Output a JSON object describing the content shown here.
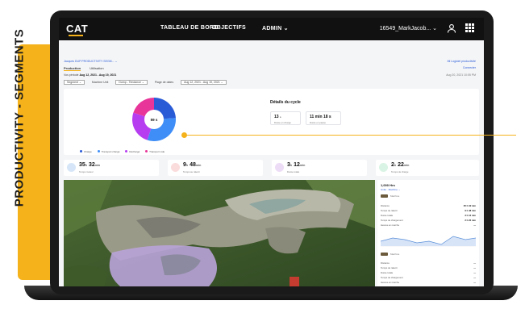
{
  "banner": {
    "text": "PRODUCTIVITY - SEGMENTS"
  },
  "nav": {
    "logo": "CAT",
    "items": [
      "TABLEAU DE BORD",
      "OBJECTIFS",
      "ADMIN ⌄"
    ],
    "user": "16549_MarkJacob... ⌄",
    "icons": [
      "user-icon",
      "apps-grid-icon"
    ]
  },
  "subheader": {
    "breadcrumb": "Jacques DUP PRODUCTIVITY SEGM... ⌄",
    "breadcrumb_right": "Mi Logiciel productivité",
    "tabs": [
      "Production",
      "Utilisation"
    ],
    "tab_right": "Connecter",
    "period_prefix": "Vos période",
    "period": "Aug 12, 2021 - Aug 19, 2021",
    "period_right": "Aug 20, 2021 10:05 PM",
    "filters": [
      {
        "label": "Segment ⌄"
      },
      {
        "label": "Machine Unit",
        "value": "Dump - Tendance ⌄"
      },
      {
        "label": "Plage de dates",
        "value": "Aug 12, 2021 - Aug 19, 2021 ⌄"
      }
    ]
  },
  "cycle": {
    "donut_center": "59 s",
    "legend": [
      "Charge",
      "Transport chargé",
      "Déchargé",
      "Transport vide"
    ],
    "details_title": "Détails du cycle",
    "minis": [
      {
        "value": "13",
        "unit": "s",
        "label": "Durée en charge"
      },
      {
        "value": "11 min 18 s",
        "unit": "",
        "label": "Durée en pause"
      }
    ]
  },
  "kpis": [
    {
      "value": "35",
      "unit1": "h",
      "value2": "32",
      "unit2": "min",
      "label": "Temps moteur",
      "color": "#5b9bd5"
    },
    {
      "value": "9",
      "unit1": "h",
      "value2": "48",
      "unit2": "min",
      "label": "Temps au ralenti",
      "color": "#f08080"
    },
    {
      "value": "3",
      "unit1": "h",
      "value2": "12",
      "unit2": "min",
      "label": "Durée totale",
      "color": "#c58ee0"
    },
    {
      "value": "2",
      "unit1": "h",
      "value2": "22",
      "unit2": "min",
      "label": "Temps de charge",
      "color": "#7ed6a0"
    }
  ],
  "panel": {
    "title": "1,000 Hrs",
    "sub": "Unité · Machine ⌄",
    "machine1": "Machine",
    "rows1": [
      {
        "label": "Distance",
        "value": "35 h 32 min"
      },
      {
        "label": "Temps de ralenti",
        "value": "9 h 48 min"
      },
      {
        "label": "Durée totale",
        "value": "3 h 12 min"
      },
      {
        "label": "Temps de chargement",
        "value": "2 h 22 min"
      },
      {
        "label": "Heures en marche",
        "value": "—"
      }
    ],
    "machine2": "Machine",
    "rows2": [
      {
        "label": "Distance",
        "value": "—"
      },
      {
        "label": "Temps de ralenti",
        "value": "—"
      },
      {
        "label": "Durée totale",
        "value": "—"
      },
      {
        "label": "Temps de chargement",
        "value": "—"
      },
      {
        "label": "Heures en marche",
        "value": "—"
      }
    ]
  },
  "donut_slices": [
    {
      "name": "Charge",
      "value": 24,
      "color": "#2a5bd7"
    },
    {
      "name": "Transport chargé",
      "value": 31,
      "color": "#3f8ef7"
    },
    {
      "name": "Déchargé",
      "value": 25,
      "color": "#b63ef0"
    },
    {
      "name": "Transport vide",
      "value": 20,
      "color": "#e8359a"
    }
  ]
}
